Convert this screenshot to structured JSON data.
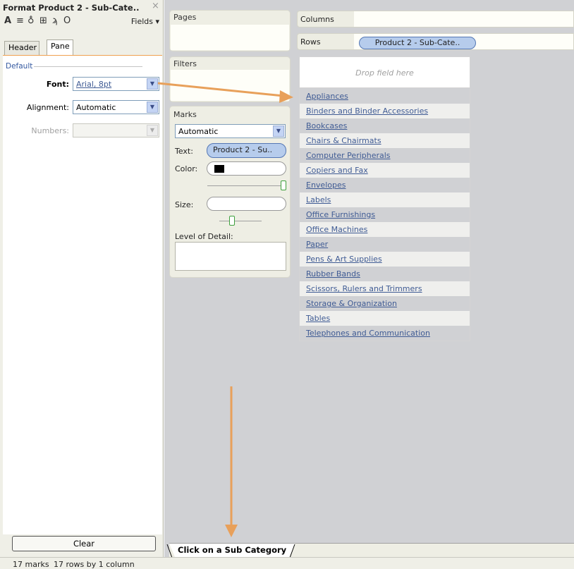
{
  "format_pane": {
    "title": "Format Product 2 - Sub-Cate..",
    "close_icon": "×",
    "toolbar": {
      "icons": [
        "font-icon",
        "alignment-icon",
        "shading-icon",
        "borders-icon",
        "lines-icon",
        "annotation-icon"
      ],
      "font_glyph": "A",
      "align_glyph": "≡",
      "shading_glyph": "♁",
      "borders_glyph": "⊞",
      "lines_glyph": "ϡ",
      "annotation_glyph": "O",
      "fields_label": "Fields ▾"
    },
    "tabs": [
      {
        "label": "Header",
        "active": false
      },
      {
        "label": "Pane",
        "active": true
      }
    ],
    "section_label": "Default",
    "font": {
      "label": "Font:",
      "value": "Arial, 8pt"
    },
    "alignment": {
      "label": "Alignment:",
      "value": "Automatic"
    },
    "numbers": {
      "label": "Numbers:",
      "value": ""
    },
    "clear_label": "Clear"
  },
  "shelves": {
    "pages_label": "Pages",
    "filters_label": "Filters",
    "marks": {
      "label": "Marks",
      "type": "Automatic",
      "text_label": "Text:",
      "text_pill": "Product 2 - Su..",
      "color_label": "Color:",
      "color_swatch": "#000000",
      "size_label": "Size:",
      "lod_label": "Level of Detail:"
    }
  },
  "view": {
    "columns_label": "Columns",
    "rows_label": "Rows",
    "rows_pill": "Product 2 - Sub-Cate..",
    "drop_placeholder": "Drop field here",
    "row_items": [
      "Appliances",
      "Binders and Binder Accessories",
      "Bookcases",
      "Chairs & Chairmats",
      "Computer Peripherals",
      "Copiers and Fax",
      "Envelopes",
      "Labels",
      "Office Furnishings",
      "Office Machines",
      "Paper",
      "Pens & Art Supplies",
      "Rubber Bands",
      "Scissors, Rulers and Trimmers",
      "Storage & Organization",
      "Tables",
      "Telephones and Communication"
    ],
    "sheet_tab": "Click on a Sub Category"
  },
  "status": {
    "marks": "17 marks",
    "rows_cols": "17 rows by 1 column"
  },
  "colors": {
    "annotation_arrow": "#e8a05a",
    "pill_fill": "#b6ccec",
    "link_text": "#3f5b94"
  }
}
